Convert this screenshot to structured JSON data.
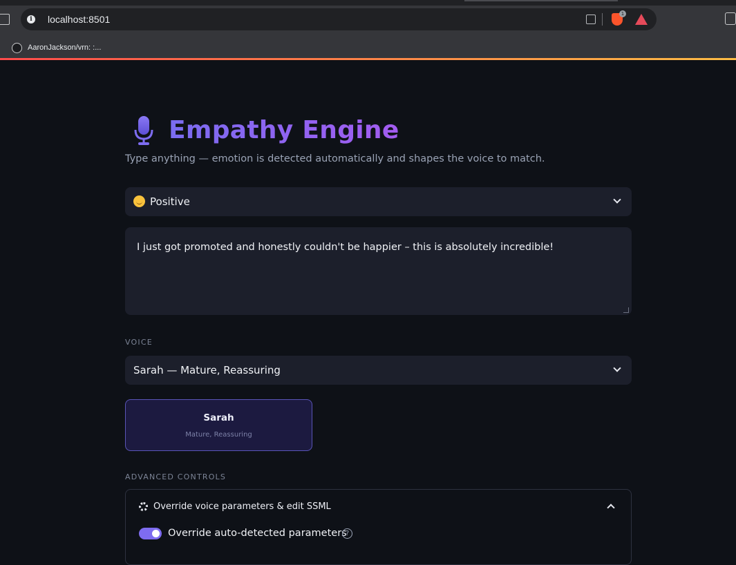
{
  "browser": {
    "url": "localhost:8501",
    "bookmark_label": "AaronJackson/vrn: :...",
    "brave_shield_count": "1"
  },
  "app": {
    "title": "Empathy Engine",
    "subtitle": "Type anything — emotion is detected automatically and shapes the voice to match.",
    "emotion_select": {
      "selected": "Positive",
      "icon": "smiling-face-emoji"
    },
    "text_input": {
      "value": "I just got promoted and honestly couldn't be happier – this is absolutely incredible!"
    },
    "voice_section_label": "VOICE",
    "voice_select": {
      "selected": "Sarah — Mature, Reassuring"
    },
    "voice_card": {
      "name": "Sarah",
      "description": "Mature, Reassuring"
    },
    "advanced_section_label": "ADVANCED CONTROLS",
    "expander": {
      "title": "Override voice parameters & edit SSML",
      "expanded": true,
      "toggle_label": "Override auto-detected parameters",
      "toggle_on": true,
      "help_glyph": "?"
    }
  },
  "colors": {
    "accent": "#7e6cf0",
    "title_gradient_start": "#7a6cf0",
    "title_gradient_end": "#a35cf0",
    "background": "#0e1117",
    "input_bg": "#1c1f2b",
    "voice_card_bg": "#1c1a40",
    "voice_card_border": "#5a55b8"
  }
}
